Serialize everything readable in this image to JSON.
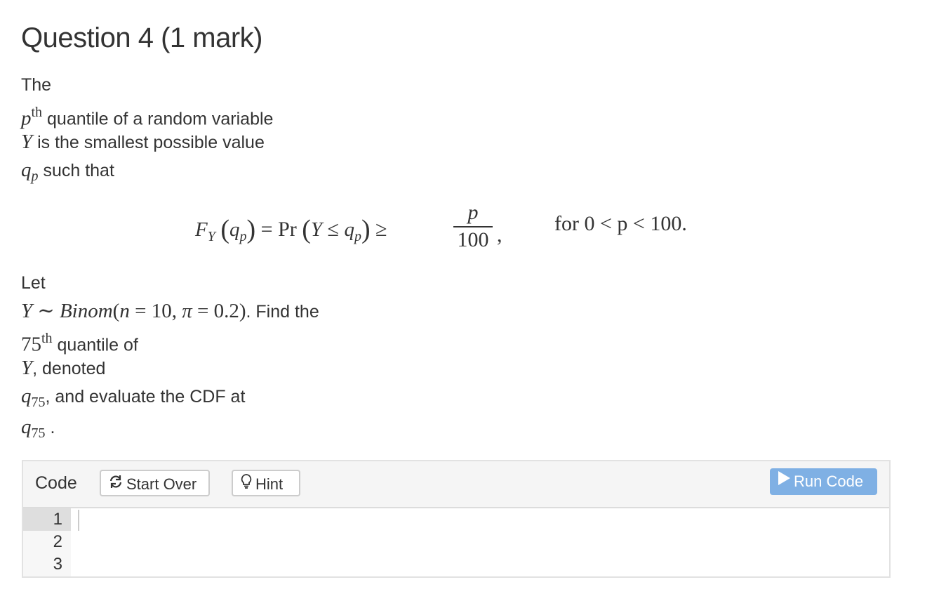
{
  "question": {
    "title": "Question 4 (1 mark)",
    "intro": {
      "the": "The",
      "p": "p",
      "th": "th",
      "quantile_text": " quantile of a random variable",
      "Y": "Y",
      "smallest_text": " is the smallest possible value",
      "q": "q",
      "p_sub": "p",
      "such_that": " such that"
    },
    "equation": {
      "F": "F",
      "Y_sub": "Y",
      "eq_pr": " = Pr ",
      "Y": "Y",
      "leq": " ≤ ",
      "q": "q",
      "p_sub": "p",
      "geq": " ≥ ",
      "num": "p",
      "den": "100",
      "comma": ",",
      "condition": "for 0 < p < 100."
    },
    "task": {
      "let": "Let",
      "Y": "Y",
      "sim": " ∼ ",
      "binom": "Binom",
      "params_open": "(",
      "n": "n",
      "eq1": " = 10, ",
      "pi": "π",
      "eq2": " = 0.2)",
      "find_the": ". Find the",
      "seventy_five": "75",
      "th": "th",
      "quantile_of": " quantile of",
      "Y2": "Y",
      "denoted": ", denoted",
      "q": "q",
      "q_sub": "75",
      "evaluate": ", and evaluate the CDF at",
      "q2": "q",
      "q2_sub": "75",
      "period": " ."
    }
  },
  "exercise": {
    "code_label": "Code",
    "start_over_label": "Start Over",
    "hint_label": "Hint",
    "run_code_label": "Run Code",
    "line_numbers": [
      "1",
      "2",
      "3"
    ],
    "code_value": ""
  },
  "colors": {
    "text": "#333333",
    "run_button_bg": "#7fb0e4",
    "toolbar_bg": "#f5f5f5",
    "gutter_bg": "#f7f7f7",
    "active_line_bg": "#dedede"
  },
  "icons": {
    "start_over": "refresh-icon",
    "hint": "lightbulb-icon",
    "run_code": "play-icon"
  }
}
